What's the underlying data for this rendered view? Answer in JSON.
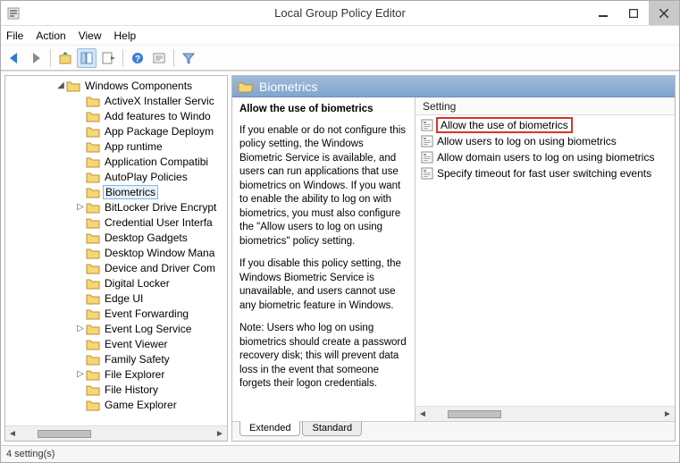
{
  "window": {
    "title": "Local Group Policy Editor"
  },
  "menubar": {
    "file": "File",
    "action": "Action",
    "view": "View",
    "help": "Help"
  },
  "toolbar_icons": {
    "back": "back-arrow-icon",
    "forward": "forward-arrow-icon",
    "up": "up-folder-icon",
    "show": "show-hide-tree-icon",
    "export": "export-list-icon",
    "help": "help-icon",
    "properties": "properties-icon",
    "filter": "filter-icon"
  },
  "tree": {
    "root_label": "Windows Components",
    "items": [
      {
        "label": "ActiveX Installer Servic",
        "expand": null
      },
      {
        "label": "Add features to Windo",
        "expand": null
      },
      {
        "label": "App Package Deploym",
        "expand": null
      },
      {
        "label": "App runtime",
        "expand": null
      },
      {
        "label": "Application Compatibi",
        "expand": null
      },
      {
        "label": "AutoPlay Policies",
        "expand": null
      },
      {
        "label": "Biometrics",
        "expand": null,
        "selected": true
      },
      {
        "label": "BitLocker Drive Encrypt",
        "expand": "closed"
      },
      {
        "label": "Credential User Interfa",
        "expand": null
      },
      {
        "label": "Desktop Gadgets",
        "expand": null
      },
      {
        "label": "Desktop Window Mana",
        "expand": null
      },
      {
        "label": "Device and Driver Com",
        "expand": null
      },
      {
        "label": "Digital Locker",
        "expand": null
      },
      {
        "label": "Edge UI",
        "expand": null
      },
      {
        "label": "Event Forwarding",
        "expand": null
      },
      {
        "label": "Event Log Service",
        "expand": "closed"
      },
      {
        "label": "Event Viewer",
        "expand": null
      },
      {
        "label": "Family Safety",
        "expand": null
      },
      {
        "label": "File Explorer",
        "expand": "closed"
      },
      {
        "label": "File History",
        "expand": null
      },
      {
        "label": "Game Explorer",
        "expand": null
      }
    ]
  },
  "content": {
    "header_title": "Biometrics",
    "setting_heading": "Allow the use of biometrics",
    "description_p1": "If you enable or do not configure this policy setting, the Windows Biometric Service is available, and users can run applications that use biometrics on Windows. If you want to enable the ability to log on with biometrics, you must also configure the \"Allow users to log on using biometrics\" policy setting.",
    "description_p2": "If you disable this policy setting, the Windows Biometric Service is unavailable, and users cannot use any biometric feature in Windows.",
    "description_p3": "Note: Users who log on using biometrics should create a password recovery disk; this will prevent data loss in the event that someone forgets their logon credentials.",
    "list_header": "Setting",
    "settings": [
      {
        "label": "Allow the use of biometrics",
        "highlighted": true
      },
      {
        "label": "Allow users to log on using biometrics"
      },
      {
        "label": "Allow domain users to log on using biometrics"
      },
      {
        "label": "Specify timeout for fast user switching events"
      }
    ]
  },
  "tabs": {
    "extended": "Extended",
    "standard": "Standard"
  },
  "statusbar": {
    "text": "4 setting(s)"
  }
}
